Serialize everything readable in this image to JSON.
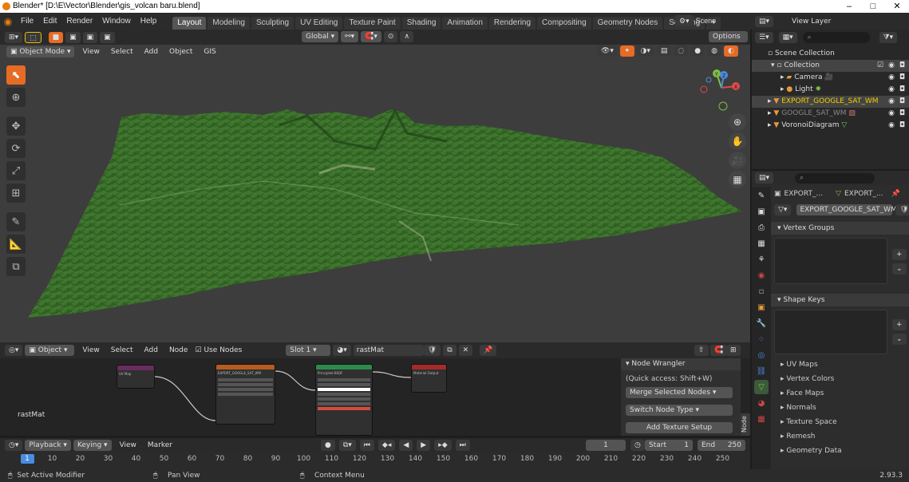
{
  "window": {
    "title": "Blender* [D:\\E\\Vector\\Blender\\gis_volcan baru.blend]",
    "min": "–",
    "max": "□",
    "close": "✕"
  },
  "menu": [
    "File",
    "Edit",
    "Render",
    "Window",
    "Help"
  ],
  "workspaces": [
    "Layout",
    "Modeling",
    "Sculpting",
    "UV Editing",
    "Texture Paint",
    "Shading",
    "Animation",
    "Rendering",
    "Compositing",
    "Geometry Nodes",
    "Scripting",
    "+"
  ],
  "scene": {
    "label": "Scene",
    "view_layer": "View Layer"
  },
  "viewport": {
    "orientation": "Global",
    "options": "Options",
    "mode": "Object Mode",
    "menu": [
      "View",
      "Select",
      "Add",
      "Object",
      "GIS"
    ],
    "gizmo": {
      "x": "X",
      "y": "Y",
      "z": "Z"
    }
  },
  "outliner": {
    "root": "Scene Collection",
    "collection": "Collection",
    "items": [
      {
        "label": "Camera",
        "color": "#e69a3c"
      },
      {
        "label": "Light",
        "color": "#e69a3c"
      },
      {
        "label": "EXPORT_GOOGLE_SAT_WM",
        "color": "#f0d000"
      },
      {
        "label": "GOOGLE_SAT_WM",
        "color": "#888888"
      },
      {
        "label": "VoronoiDiagram",
        "color": "#dddddd"
      }
    ]
  },
  "properties": {
    "breadcrumb1": "EXPORT_...",
    "breadcrumb2": "EXPORT_...",
    "object_name": "EXPORT_GOOGLE_SAT_WM",
    "panels": [
      "Vertex Groups",
      "Shape Keys"
    ],
    "sections": [
      "UV Maps",
      "Vertex Colors",
      "Face Maps",
      "Normals",
      "Texture Space",
      "Remesh",
      "Geometry Data"
    ]
  },
  "node_editor": {
    "type": "Object",
    "menu": [
      "View",
      "Select",
      "Add",
      "Node"
    ],
    "use_nodes": "Use Nodes",
    "slot": "Slot 1",
    "material": "rastMat",
    "material_label": "rastMat",
    "nodes": [
      "UV Map",
      "EXPORT_GOOGLE_SAT_WM",
      "Principled BSDF",
      "Material Output"
    ],
    "wrangler": {
      "title": "Node Wrangler",
      "quick": "(Quick access: Shift+W)",
      "merge": "Merge Selected Nodes",
      "switch": "Switch Node Type",
      "texture": "Add Texture Setup",
      "tab": "Node"
    }
  },
  "timeline": {
    "playback": "Playback",
    "keying": "Keying",
    "view": "View",
    "marker": "Marker",
    "current_frame": "1",
    "start_label": "Start",
    "start": "1",
    "end_label": "End",
    "end": "250",
    "ticks": [
      "1",
      "10",
      "20",
      "30",
      "40",
      "50",
      "60",
      "70",
      "80",
      "90",
      "100",
      "110",
      "120",
      "130",
      "140",
      "150",
      "160",
      "170",
      "180",
      "190",
      "200",
      "210",
      "220",
      "230",
      "240",
      "250"
    ]
  },
  "status": {
    "left": "Set Active Modifier",
    "mid": "Pan View",
    "right": "Context Menu",
    "version": "2.93.3"
  },
  "colors": {
    "accent": "#e66b24",
    "selected": "#334d80",
    "terrain": "#3f7a2e"
  }
}
